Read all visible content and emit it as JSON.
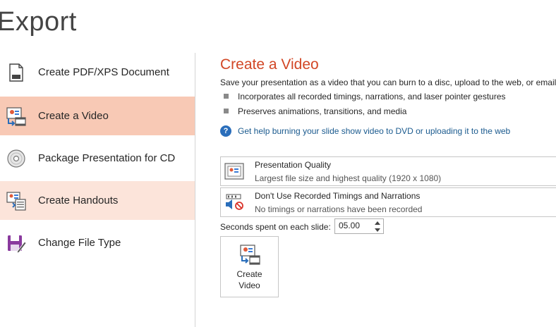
{
  "page": {
    "title": "Export"
  },
  "sidebar": {
    "items": [
      {
        "label": "Create PDF/XPS Document",
        "icon": "pdf-document-icon",
        "state": "normal"
      },
      {
        "label": "Create a Video",
        "icon": "video-icon",
        "state": "selected"
      },
      {
        "label": "Package Presentation for CD",
        "icon": "cd-icon",
        "state": "normal"
      },
      {
        "label": "Create Handouts",
        "icon": "handouts-icon",
        "state": "hover"
      },
      {
        "label": "Change File Type",
        "icon": "save-as-icon",
        "state": "normal"
      }
    ]
  },
  "main": {
    "title": "Create a Video",
    "description": "Save your presentation as a video that you can burn to a disc, upload to the web, or email",
    "bullets": [
      "Incorporates all recorded timings, narrations, and laser pointer gestures",
      "Preserves animations, transitions, and media"
    ],
    "help_link": "Get help burning your slide show video to DVD or uploading it to the web",
    "quality_dropdown": {
      "title": "Presentation Quality",
      "subtitle": "Largest file size and highest quality (1920 x 1080)"
    },
    "timings_dropdown": {
      "title": "Don't Use Recorded Timings and Narrations",
      "subtitle": "No timings or narrations have been recorded"
    },
    "seconds_label": "Seconds spent on each slide:",
    "seconds_value": "05.00",
    "create_button": {
      "line1": "Create",
      "line2": "Video"
    }
  },
  "colors": {
    "accent": "#d24726",
    "selected_bg": "#f8c9b5",
    "hover_bg": "#fce4da",
    "link": "#1a5a8e"
  }
}
